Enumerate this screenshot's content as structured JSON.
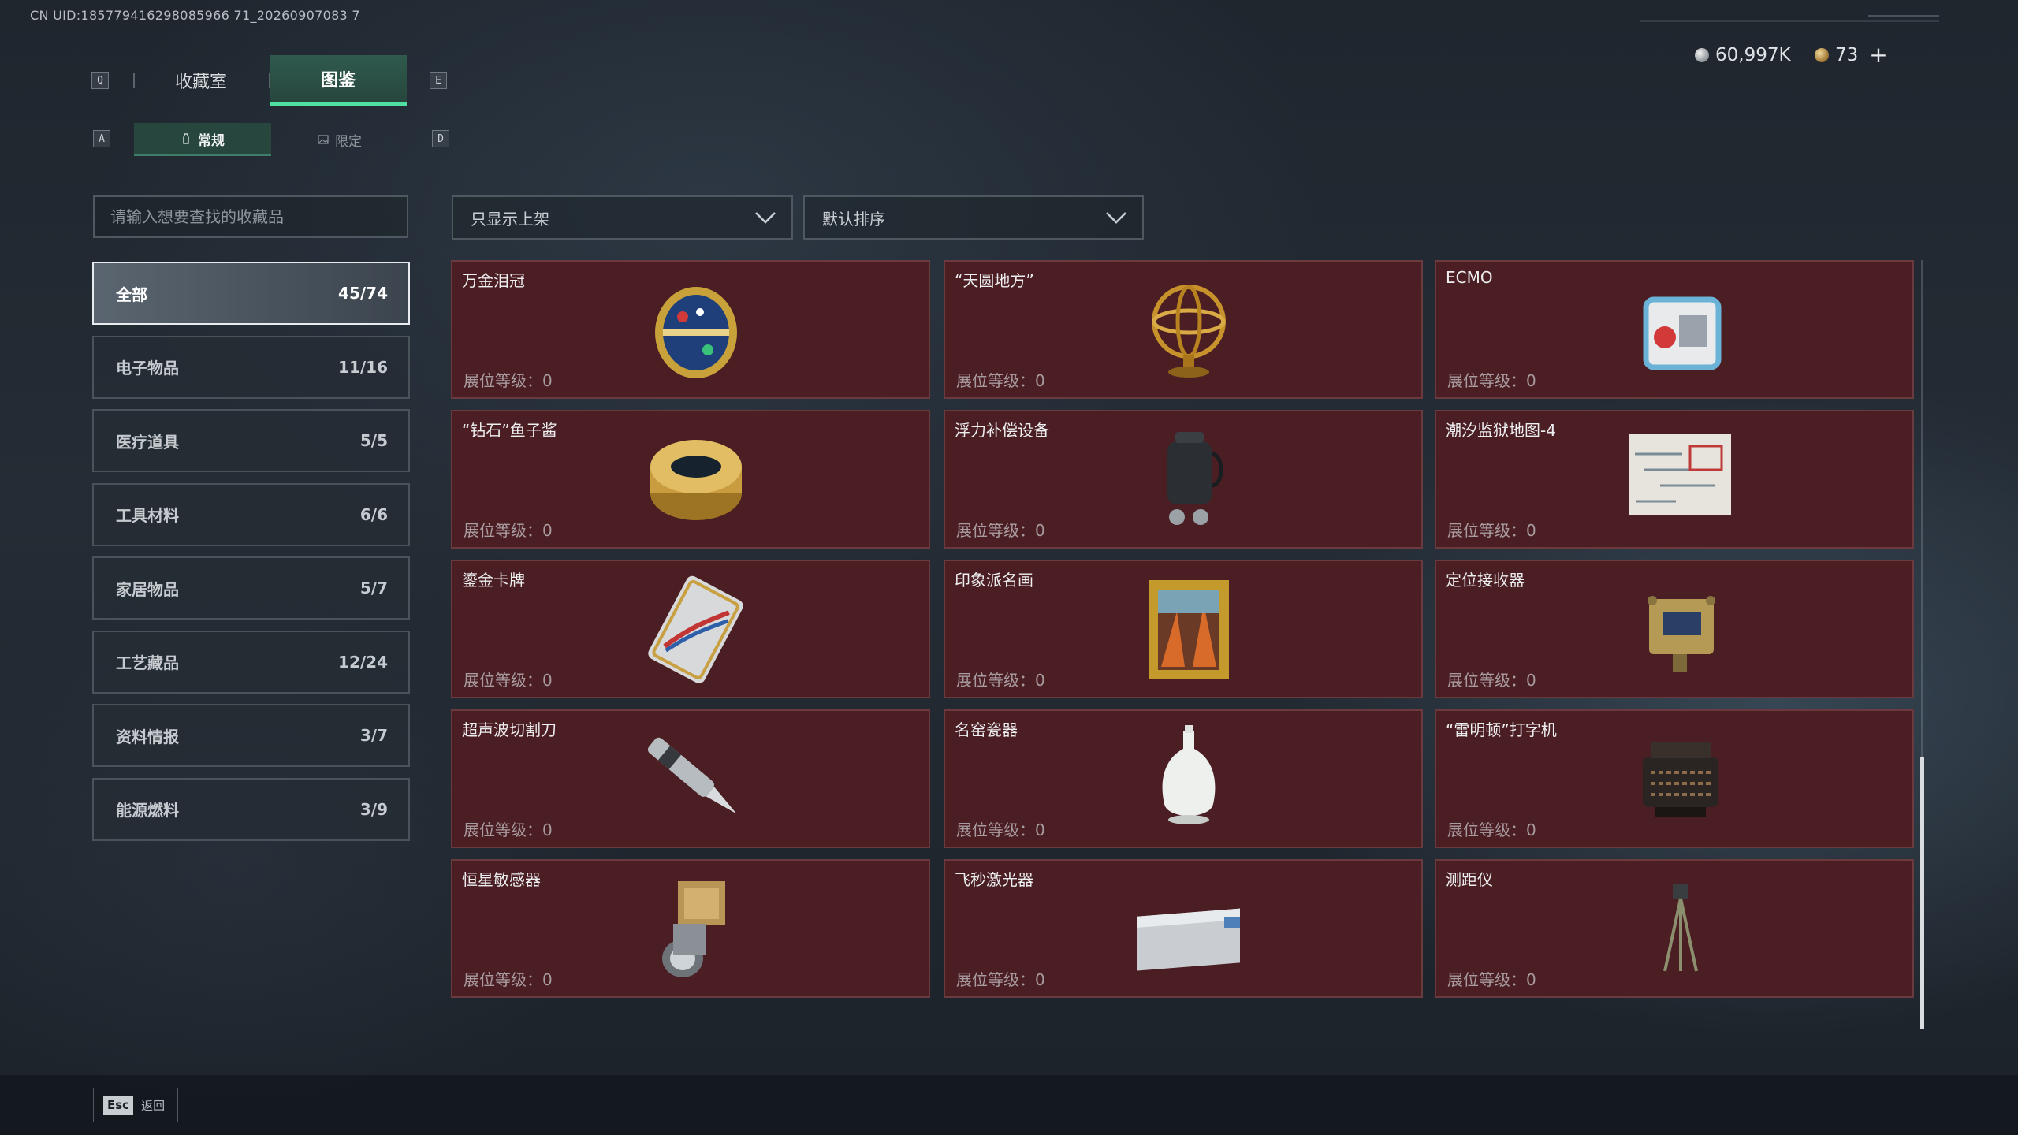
{
  "uid_text": "CN UID:185779416298085966 71_20260907083 7",
  "currency": {
    "silver": "60,997K",
    "gold": "73",
    "plus": "+"
  },
  "keys": {
    "prev_tab": "Q",
    "next_tab": "E",
    "prev_sub": "A",
    "next_sub": "D"
  },
  "tabs": [
    {
      "label": "收藏室"
    },
    {
      "label": "图鉴"
    }
  ],
  "subtabs": [
    {
      "label": "常规"
    },
    {
      "label": "限定"
    }
  ],
  "search": {
    "placeholder": "请输入想要查找的收藏品"
  },
  "filters": {
    "shelf": "只显示上架",
    "sort": "默认排序"
  },
  "categories": [
    {
      "label": "全部",
      "count": "45/74"
    },
    {
      "label": "电子物品",
      "count": "11/16"
    },
    {
      "label": "医疗道具",
      "count": "5/5"
    },
    {
      "label": "工具材料",
      "count": "6/6"
    },
    {
      "label": "家居物品",
      "count": "5/7"
    },
    {
      "label": "工艺藏品",
      "count": "12/24"
    },
    {
      "label": "资料情报",
      "count": "3/7"
    },
    {
      "label": "能源燃料",
      "count": "3/9"
    }
  ],
  "level_label": "展位等级：",
  "level_value": "0",
  "items": [
    {
      "name": "",
      "icon": "partial-item"
    },
    {
      "name": "",
      "icon": "partial-item"
    },
    {
      "name": "",
      "icon": "partial-item"
    },
    {
      "name": "万金泪冠",
      "icon": "jeweled-egg-icon"
    },
    {
      "name": "“天圆地方”",
      "icon": "armillary-sphere-icon"
    },
    {
      "name": "ECMO",
      "icon": "ecmo-machine-icon"
    },
    {
      "name": "“钻石”鱼子酱",
      "icon": "caviar-tin-icon"
    },
    {
      "name": "浮力补偿设备",
      "icon": "buoyancy-device-icon"
    },
    {
      "name": "潮汐监狱地图-4",
      "icon": "prison-map-icon"
    },
    {
      "name": "鎏金卡牌",
      "icon": "gilded-card-icon"
    },
    {
      "name": "印象派名画",
      "icon": "painting-icon"
    },
    {
      "name": "定位接收器",
      "icon": "locator-receiver-icon"
    },
    {
      "name": "超声波切割刀",
      "icon": "ultrasonic-cutter-icon"
    },
    {
      "name": "名窑瓷器",
      "icon": "porcelain-vase-icon"
    },
    {
      "name": "“雷明顿”打字机",
      "icon": "typewriter-icon"
    },
    {
      "name": "恒星敏感器",
      "icon": "star-sensor-icon"
    },
    {
      "name": "飞秒激光器",
      "icon": "femtosecond-laser-icon"
    },
    {
      "name": "测距仪",
      "icon": "rangefinder-icon"
    }
  ],
  "esc": {
    "key": "Esc",
    "label": "返回"
  },
  "colors": {
    "accent": "#4fe0a2",
    "card_bg": "#4b1e23",
    "card_border": "#6a3a3f"
  }
}
